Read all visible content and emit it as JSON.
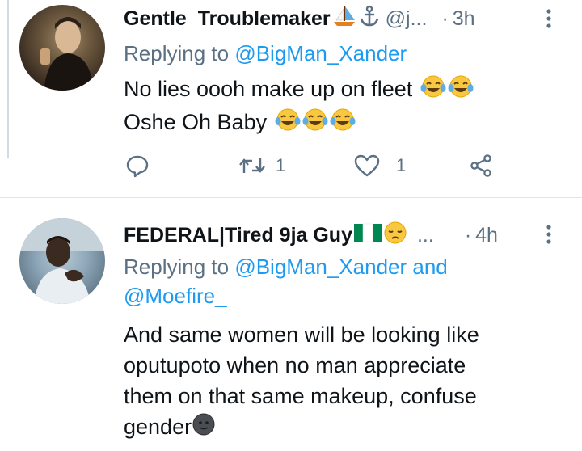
{
  "tweets": [
    {
      "display_name": "Gentle_Troublemaker",
      "name_emojis": [
        "sailboat-emoji",
        "anchor-emoji"
      ],
      "handle": "@j...",
      "time": "3h",
      "replying_prefix": "Replying to",
      "replying_to": [
        "@BigMan_Xander"
      ],
      "text_lines": [
        "No lies oooh make up on fleet",
        "Oshe Oh Baby"
      ],
      "reply_count": "",
      "retweet_count": "1",
      "like_count": "1"
    },
    {
      "display_name": "FEDERAL|Tired 9ja Guy",
      "name_emojis": [
        "nigeria-flag-emoji",
        "pensive-face-emoji"
      ],
      "handle": "...",
      "time": "4h",
      "replying_prefix": "Replying to",
      "replying_to_line1": "@BigMan_Xander and",
      "replying_to_line2": "@Moefire_",
      "text_lines": [
        "And same women will be looking like",
        "oputupoto when no man appreciate",
        "them on that same makeup, confuse",
        "gender"
      ]
    }
  ],
  "separators": {
    "time_dot": "·"
  },
  "colors": {
    "accent": "#1d9bf0",
    "muted": "#5b7083",
    "text": "#0f1419"
  }
}
